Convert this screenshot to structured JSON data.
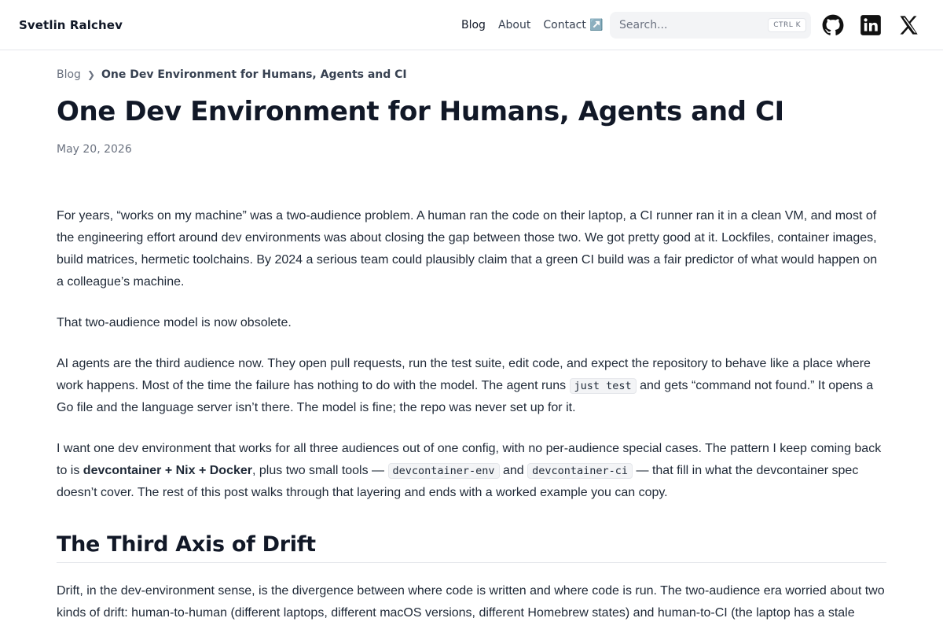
{
  "header": {
    "site_name": "Svetlin Ralchev",
    "nav": {
      "blog": "Blog",
      "about": "About",
      "contact": "Contact ↗️"
    },
    "search": {
      "placeholder": "Search...",
      "shortcut": "CTRL K"
    },
    "social": [
      "github-icon",
      "linkedin-icon",
      "x-icon"
    ]
  },
  "breadcrumb": {
    "parent": "Blog",
    "current": "One Dev Environment for Humans, Agents and CI"
  },
  "article": {
    "title": "One Dev Environment for Humans, Agents and CI",
    "date": "May 20, 2026",
    "p1": "For years, “works on my machine” was a two-audience problem. A human ran the code on their laptop, a CI runner ran it in a clean VM, and most of the engineering effort around dev environments was about closing the gap between those two. We got pretty good at it. Lockfiles, container images, build matrices, hermetic toolchains. By 2024 a serious team could plausibly claim that a green CI build was a fair predictor of what would happen on a colleague’s machine.",
    "p2": "That two-audience model is now obsolete.",
    "p3": {
      "a": "AI agents are the third audience now. They open pull requests, run the test suite, edit code, and expect the repository to behave like a place where work happens. Most of the time the failure has nothing to do with the model. The agent runs ",
      "code": "just test",
      "b": " and gets “command not found.” It opens a Go file and the language server isn’t there. The model is fine; the repo was never set up for it."
    },
    "p4": {
      "a": "I want one dev environment that works for all three audiences out of one config, with no per-audience special cases. The pattern I keep coming back to is ",
      "strong": "devcontainer + Nix + Docker",
      "b": ", plus two small tools — ",
      "code1": "devcontainer-env",
      "c": " and ",
      "code2": "devcontainer-ci",
      "d": " — that fill in what the devcontainer spec doesn’t cover. The rest of this post walks through that layering and ends with a worked example you can copy."
    },
    "h2": "The Third Axis of Drift",
    "p5": "Drift, in the dev-environment sense, is the divergence between where code is written and where code is run. The two-audience era worried about two kinds of drift: human-to-human (different laptops, different macOS versions, different Homebrew states) and human-to-CI (the laptop has a stale"
  }
}
